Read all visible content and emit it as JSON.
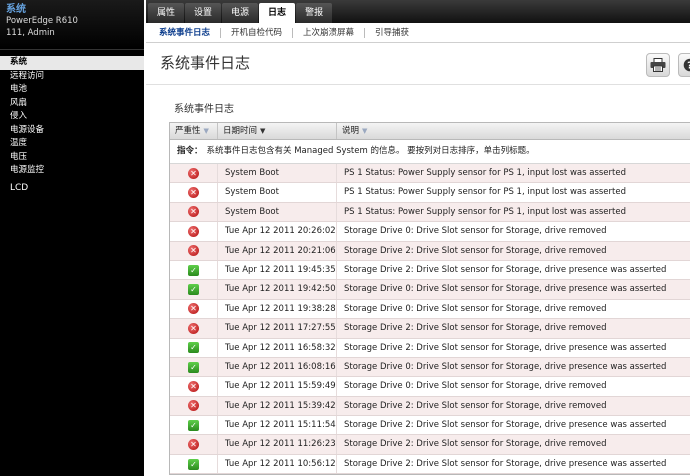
{
  "sidebar": {
    "system": {
      "title": "系统",
      "model": "PowerEdge R610",
      "user": "111, Admin"
    },
    "items": [
      {
        "label": "系统",
        "active": true
      },
      {
        "label": "远程访问"
      },
      {
        "label": "电池"
      },
      {
        "label": "风扇"
      },
      {
        "label": "侵入"
      },
      {
        "label": "电源设备"
      },
      {
        "label": "温度"
      },
      {
        "label": "电压"
      },
      {
        "label": "电源监控"
      }
    ],
    "lcd": "LCD"
  },
  "tabs": [
    "属性",
    "设置",
    "电源",
    "日志",
    "警报"
  ],
  "active_tab": "日志",
  "subtabs": [
    "系统事件日志",
    "开机自检代码",
    "上次崩溃屏幕",
    "引导捕获"
  ],
  "active_subtab": "系统事件日志",
  "page_title": "系统事件日志",
  "toolbar": {
    "print_icon": "printer-icon",
    "help_icon": "help-icon"
  },
  "section_title": "系统事件日志",
  "table": {
    "headers": {
      "severity": "严重性",
      "datetime": "日期时间",
      "description": "说明"
    },
    "sorted_column": "datetime",
    "hint_label": "指令：",
    "hint_text": "系统事件日志包含有关 Managed System 的信息。 要按列对日志排序，单击列标题。",
    "rows": [
      {
        "severity": "critical",
        "datetime": "System Boot",
        "description": "PS 1 Status: Power Supply sensor for PS 1, input lost was asserted"
      },
      {
        "severity": "critical",
        "datetime": "System Boot",
        "description": "PS 1 Status: Power Supply sensor for PS 1, input lost was asserted"
      },
      {
        "severity": "critical",
        "datetime": "System Boot",
        "description": "PS 1 Status: Power Supply sensor for PS 1, input lost was asserted"
      },
      {
        "severity": "critical",
        "datetime": "Tue Apr 12 2011 20:26:02",
        "description": "Storage Drive 0: Drive Slot sensor for Storage, drive removed"
      },
      {
        "severity": "critical",
        "datetime": "Tue Apr 12 2011 20:21:06",
        "description": "Storage Drive 2: Drive Slot sensor for Storage, drive removed"
      },
      {
        "severity": "normal",
        "datetime": "Tue Apr 12 2011 19:45:35",
        "description": "Storage Drive 2: Drive Slot sensor for Storage, drive presence was asserted"
      },
      {
        "severity": "normal",
        "datetime": "Tue Apr 12 2011 19:42:50",
        "description": "Storage Drive 0: Drive Slot sensor for Storage, drive presence was asserted"
      },
      {
        "severity": "critical",
        "datetime": "Tue Apr 12 2011 19:38:28",
        "description": "Storage Drive 0: Drive Slot sensor for Storage, drive removed"
      },
      {
        "severity": "critical",
        "datetime": "Tue Apr 12 2011 17:27:55",
        "description": "Storage Drive 2: Drive Slot sensor for Storage, drive removed"
      },
      {
        "severity": "normal",
        "datetime": "Tue Apr 12 2011 16:58:32",
        "description": "Storage Drive 2: Drive Slot sensor for Storage, drive presence was asserted"
      },
      {
        "severity": "normal",
        "datetime": "Tue Apr 12 2011 16:08:16",
        "description": "Storage Drive 0: Drive Slot sensor for Storage, drive presence was asserted"
      },
      {
        "severity": "critical",
        "datetime": "Tue Apr 12 2011 15:59:49",
        "description": "Storage Drive 0: Drive Slot sensor for Storage, drive removed"
      },
      {
        "severity": "critical",
        "datetime": "Tue Apr 12 2011 15:39:42",
        "description": "Storage Drive 2: Drive Slot sensor for Storage, drive removed"
      },
      {
        "severity": "normal",
        "datetime": "Tue Apr 12 2011 15:11:54",
        "description": "Storage Drive 2: Drive Slot sensor for Storage, drive presence was asserted"
      },
      {
        "severity": "critical",
        "datetime": "Tue Apr 12 2011 11:26:23",
        "description": "Storage Drive 2: Drive Slot sensor for Storage, drive removed"
      },
      {
        "severity": "normal",
        "datetime": "Tue Apr 12 2011 10:56:12",
        "description": "Storage Drive 2: Drive Slot sensor for Storage, drive presence was asserted"
      }
    ]
  }
}
